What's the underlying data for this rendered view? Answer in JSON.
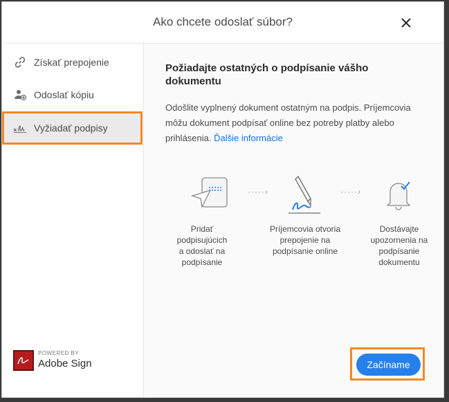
{
  "dialog": {
    "title": "Ako chcete odoslať súbor?",
    "close_icon": "close-icon"
  },
  "sidebar": {
    "items": [
      {
        "label": "Získať prepojenie",
        "icon": "link-icon",
        "selected": false
      },
      {
        "label": "Odoslať kópiu",
        "icon": "add-user-icon",
        "selected": false
      },
      {
        "label": "Vyžiadať podpisy",
        "icon": "signature-icon",
        "selected": true
      }
    ]
  },
  "main": {
    "heading": "Požiadajte ostatných o podpísanie vášho dokumentu",
    "description": "Odošlite vyplnený dokument ostatným na podpis. Príjemcovia môžu dokument podpísať online bez potreby platby alebo prihlásenia.",
    "learn_more": "Ďalšie informácie",
    "steps": [
      {
        "icon": "send-document-icon",
        "label": "Pridať podpisujúcich a odoslať na podpísanie"
      },
      {
        "icon": "pen-sign-icon",
        "label": "Príjemcovia otvoria prepojenie na podpísanie online"
      },
      {
        "icon": "bell-check-icon",
        "label": "Dostávajte upozornenia na podpísanie dokumentu"
      }
    ],
    "step_arrow": "·····›"
  },
  "footer": {
    "powered_by": "POWERED BY",
    "brand": "Adobe Sign",
    "cta_label": "Začíname"
  },
  "colors": {
    "accent": "#2680eb",
    "highlight": "#f08a24",
    "link": "#1473e6"
  }
}
